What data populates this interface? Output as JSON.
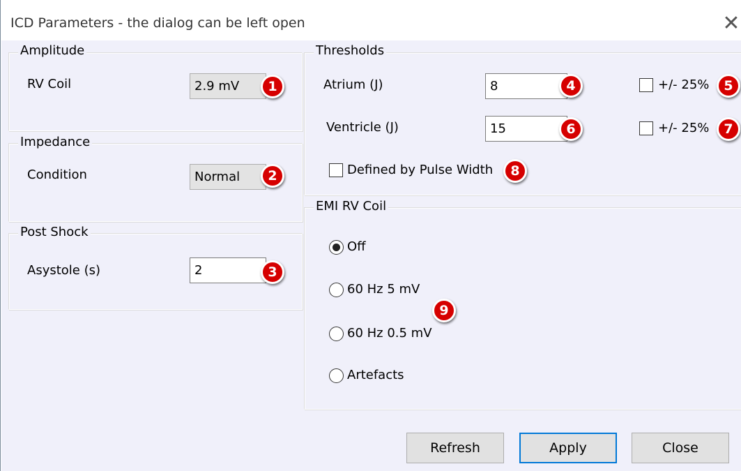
{
  "window": {
    "title": "ICD Parameters - the dialog can be left open",
    "close_glyph": "✕"
  },
  "amplitude": {
    "legend": "Amplitude",
    "rv_coil_label": "RV Coil",
    "rv_coil_value": "2.9 mV",
    "badge": "1"
  },
  "impedance": {
    "legend": "Impedance",
    "condition_label": "Condition",
    "condition_value": "Normal",
    "badge": "2"
  },
  "post_shock": {
    "legend": "Post Shock",
    "asystole_label": "Asystole (s)",
    "asystole_value": "2",
    "badge": "3"
  },
  "thresholds": {
    "legend": "Thresholds",
    "atrium_label": "Atrium (J)",
    "atrium_value": "8",
    "atrium_badge": "4",
    "atrium_tolerance_label": "+/- 25%",
    "atrium_tolerance_checked": false,
    "atrium_tolerance_badge": "5",
    "ventricle_label": "Ventricle (J)",
    "ventricle_value": "15",
    "ventricle_badge": "6",
    "ventricle_tolerance_label": "+/- 25%",
    "ventricle_tolerance_checked": false,
    "ventricle_tolerance_badge": "7",
    "pulse_width_label": "Defined by Pulse Width",
    "pulse_width_checked": false,
    "pulse_width_badge": "8"
  },
  "emi": {
    "legend": "EMI RV Coil",
    "options": [
      {
        "label": "Off",
        "selected": true
      },
      {
        "label": "60 Hz 5 mV",
        "selected": false
      },
      {
        "label": "60 Hz 0.5 mV",
        "selected": false
      },
      {
        "label": "Artefacts",
        "selected": false
      }
    ],
    "badge": "9"
  },
  "buttons": {
    "refresh": "Refresh",
    "apply": "Apply",
    "close": "Close"
  },
  "colors": {
    "badge_red": "#d60000",
    "dialog_background": "#f0f0fa",
    "default_button_border": "#0078d7"
  }
}
